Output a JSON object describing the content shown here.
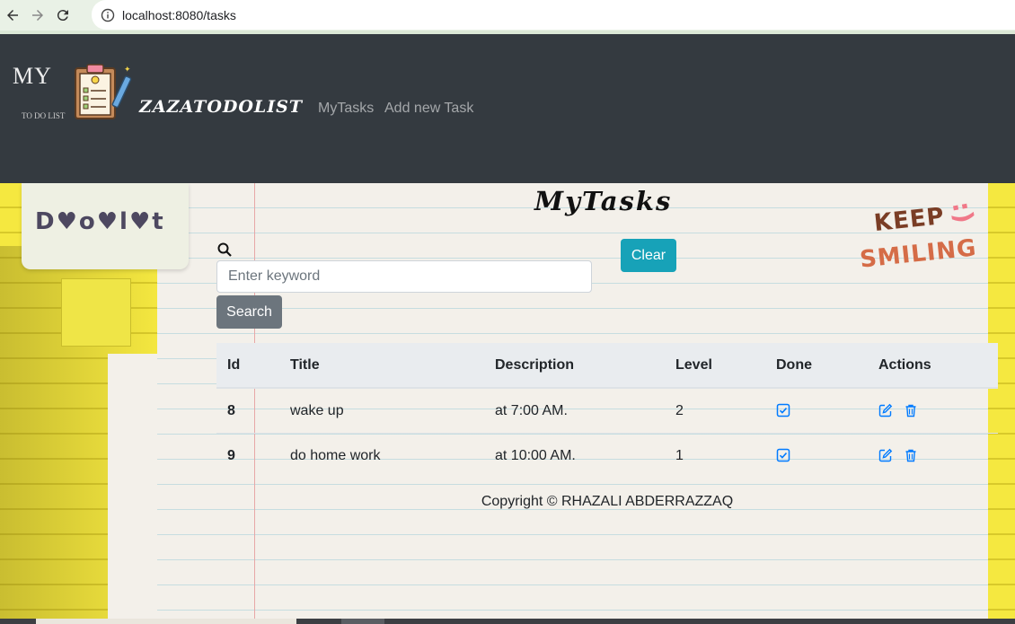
{
  "browser": {
    "url": "localhost:8080/tasks"
  },
  "navbar": {
    "logo_my": "MY",
    "logo_sub": "TO DO LIST",
    "brand": "ZAZATODOLIST",
    "links": [
      "MyTasks",
      "Add new Task"
    ]
  },
  "decor": {
    "sticky_text": "D♥o♥l♥t",
    "keep_line1": "KEEP",
    "keep_line2": "SMILING",
    "smiley": ":)"
  },
  "page": {
    "title": "MyTasks"
  },
  "search": {
    "placeholder": "Enter keyword",
    "value": "",
    "search_label": "Search",
    "clear_label": "Clear"
  },
  "table": {
    "headers": [
      "Id",
      "Title",
      "Description",
      "Level",
      "Done",
      "Actions"
    ],
    "rows": [
      {
        "id": "8",
        "title": "wake up",
        "description": "at 7:00 AM.",
        "level": "2",
        "done": true
      },
      {
        "id": "9",
        "title": "do home work",
        "description": "at 10:00 AM.",
        "level": "1",
        "done": true
      }
    ]
  },
  "footer": {
    "text": "Copyright © RHAZALI ABDERRAZZAQ"
  },
  "colors": {
    "navbar": "#343a40",
    "clear_button": "#17a2b8",
    "search_button": "#6c757d",
    "action_icons": "#007bff"
  }
}
